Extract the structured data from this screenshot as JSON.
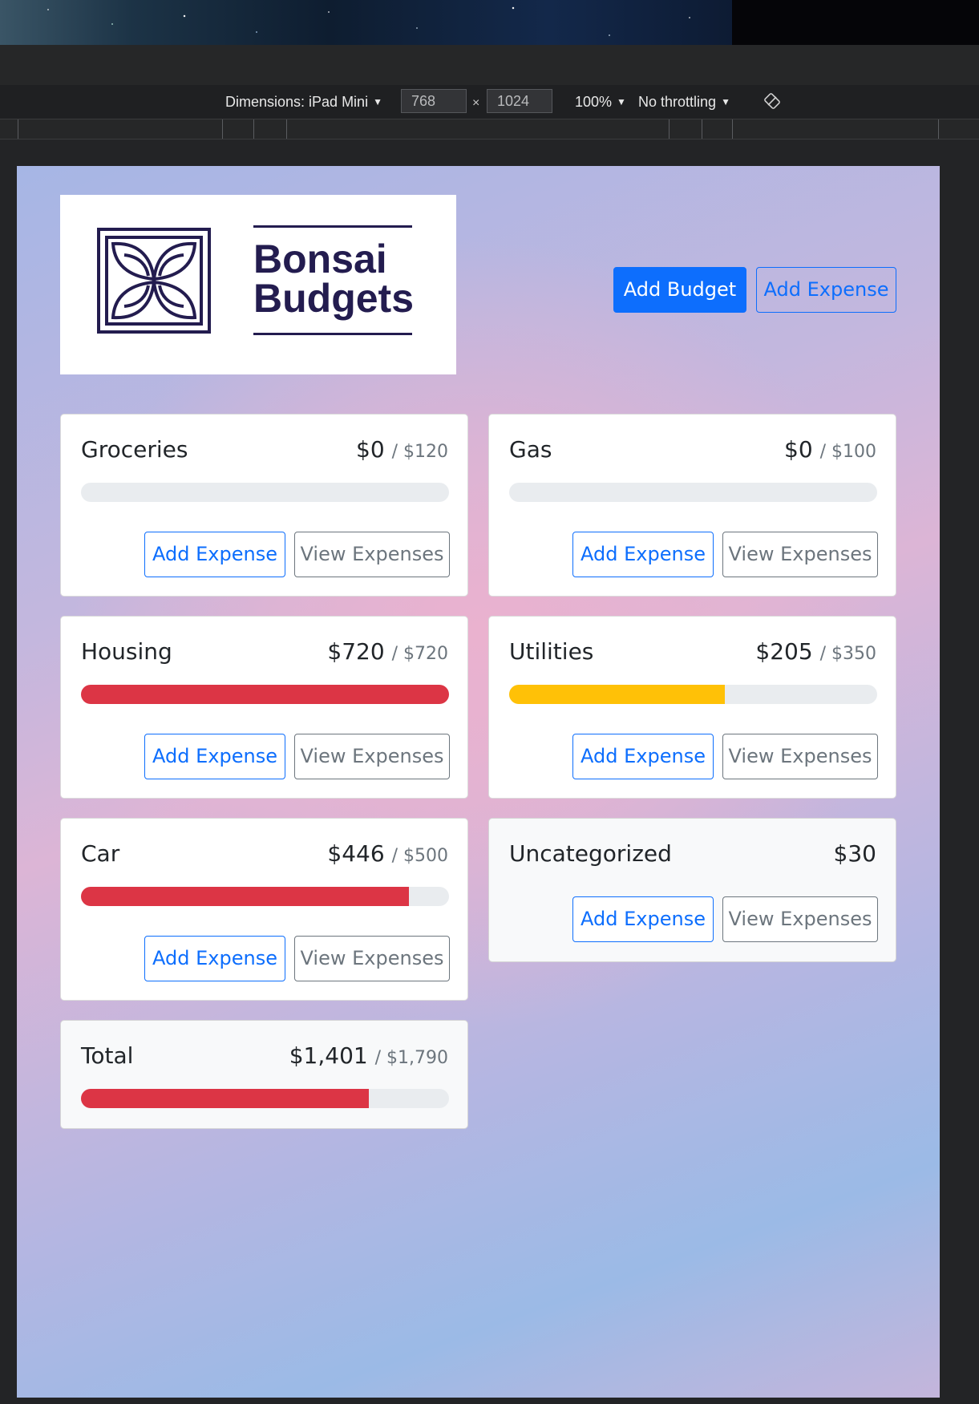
{
  "devtools": {
    "dimensions_label": "Dimensions: iPad Mini",
    "width": "768",
    "height": "1024",
    "times": "×",
    "zoom": "100%",
    "throttling": "No throttling",
    "caret": "▼",
    "rotate_icon": "rotate-device-icon"
  },
  "logo": {
    "line1": "Bonsai",
    "line2": "Budgets",
    "icon": "bonsai-logo-icon",
    "color": "#231c4f"
  },
  "header": {
    "add_budget": "Add Budget",
    "add_expense": "Add Expense"
  },
  "colors": {
    "primary": "#0d6efd",
    "secondary": "#6c757d",
    "danger": "#dc3545",
    "warning": "#ffc107",
    "track": "#e9ecef"
  },
  "budgets": [
    {
      "name": "Groceries",
      "amount": "$0",
      "max": "/ $120",
      "progress": 0,
      "bar_color": "none",
      "add_label": "Add Expense",
      "view_label": "View Expenses"
    },
    {
      "name": "Gas",
      "amount": "$0",
      "max": "/ $100",
      "progress": 0,
      "bar_color": "none",
      "add_label": "Add Expense",
      "view_label": "View Expenses"
    },
    {
      "name": "Housing",
      "amount": "$720",
      "max": "/ $720",
      "progress": 1.0,
      "bar_color": "#dc3545",
      "add_label": "Add Expense",
      "view_label": "View Expenses"
    },
    {
      "name": "Utilities",
      "amount": "$205",
      "max": "/ $350",
      "progress": 0.586,
      "bar_color": "#ffc107",
      "add_label": "Add Expense",
      "view_label": "View Expenses"
    },
    {
      "name": "Car",
      "amount": "$446",
      "max": "/ $500",
      "progress": 0.892,
      "bar_color": "#dc3545",
      "add_label": "Add Expense",
      "view_label": "View Expenses"
    },
    {
      "name": "Uncategorized",
      "amount": "$30",
      "add_label": "Add Expense",
      "view_label": "View Expenses"
    }
  ],
  "total": {
    "name": "Total",
    "amount": "$1,401",
    "max": "/ $1,790",
    "progress": 0.783,
    "bar_color": "#dc3545"
  }
}
